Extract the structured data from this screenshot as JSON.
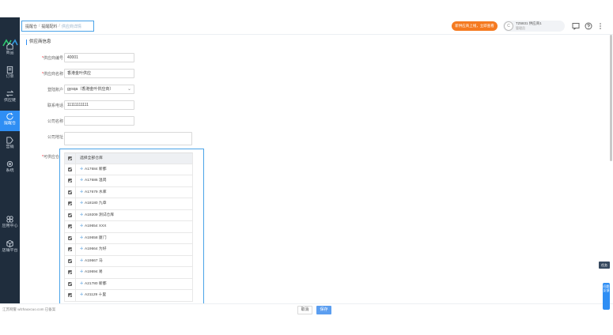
{
  "header": {
    "breadcrumb": [
      "提醒仓",
      "提醒配料",
      "供应商详情"
    ],
    "promo_label": "新供应商上线，立即查看",
    "account": {
      "avatar": "C",
      "name": "TZ6831 供应商1",
      "sub": "管理员"
    }
  },
  "sidebar": {
    "items": [
      {
        "label": "商品"
      },
      {
        "label": "订单"
      },
      {
        "label": "供应链"
      },
      {
        "label": "提醒仓"
      },
      {
        "label": "营销"
      },
      {
        "label": "系统"
      },
      {
        "label": "应用中心"
      },
      {
        "label": "店铺平台"
      }
    ]
  },
  "form": {
    "section_title": "供应商信息",
    "rows": [
      {
        "label": "供应商编号",
        "required": true,
        "value": "40001",
        "type": "text"
      },
      {
        "label": "供应商名称",
        "required": true,
        "value": "香港金叶供应",
        "type": "text"
      },
      {
        "label": "登陆账户",
        "required": false,
        "value": "gysqa（香港金叶供应商）",
        "type": "select"
      },
      {
        "label": "联系电话",
        "required": false,
        "value": "11111111111",
        "type": "text"
      },
      {
        "label": "公司名称",
        "required": false,
        "value": "",
        "type": "text"
      },
      {
        "label": "公司地址",
        "required": false,
        "value": "",
        "type": "textarea"
      }
    ],
    "warehouse_label": "可供应仓库",
    "warehouse_header": "选择全部仓库",
    "warehouses": [
      "A17684 新都",
      "A17686 温岗",
      "A17679 水库",
      "A18180 九章",
      "A19209 测试仓库",
      "A19654 XXX",
      "A19658 厦门",
      "A19664 为好",
      "A19667 马",
      "A19694 易",
      "A21780 新都",
      "A21129 十里"
    ]
  },
  "footer": {
    "icp": "江苏网警 wlzhaoxcuo.com 已备案",
    "cancel_label": "取消",
    "save_label": "保存"
  },
  "side": {
    "tab_label": "任务",
    "feedback_label": "问题反馈"
  },
  "colors": {
    "sidebar_bg": "#1f2d3d",
    "active": "#2f8ef4",
    "promo": "#f57a20",
    "highlight_border": "#4aa3e8"
  }
}
